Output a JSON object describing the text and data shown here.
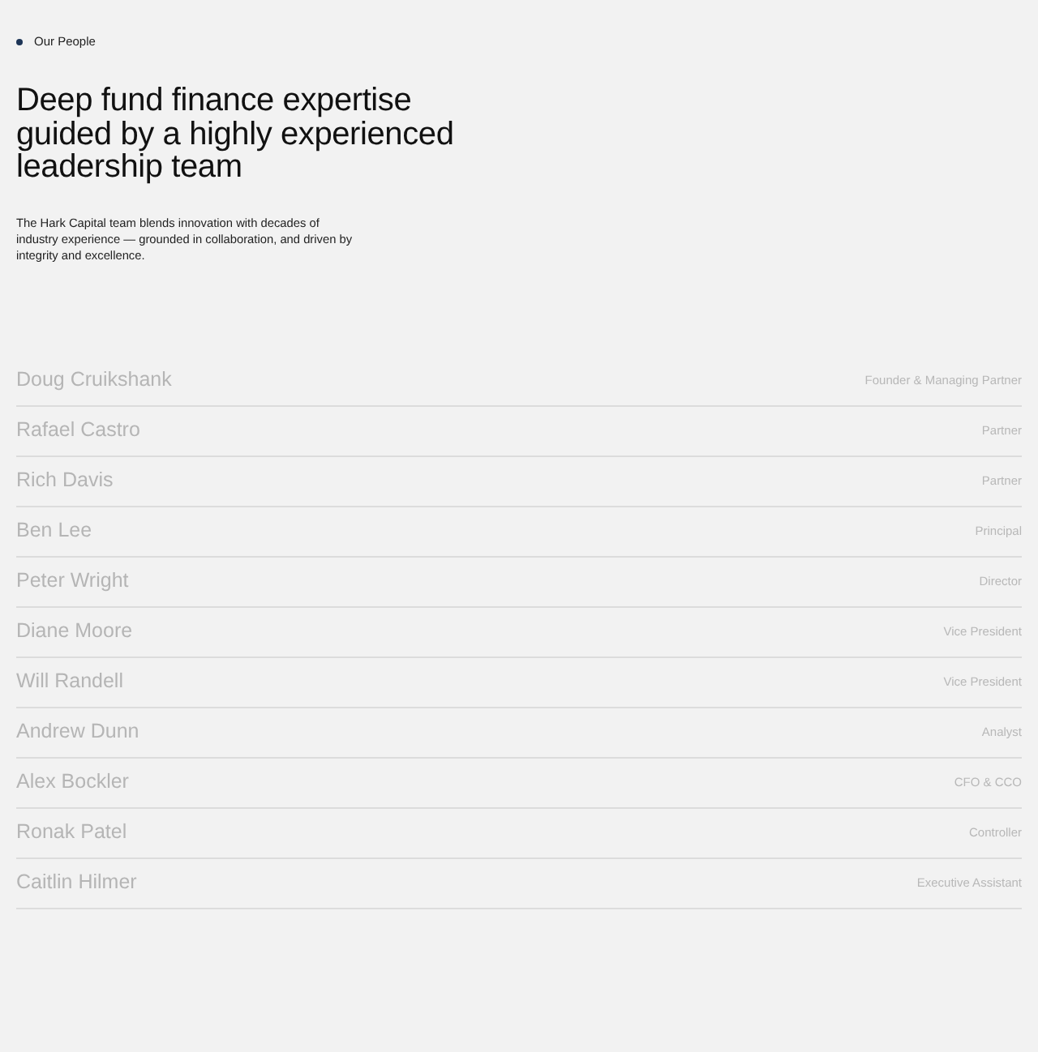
{
  "eyebrow": "Our People",
  "heading": "Deep fund finance expertise guided by a highly experienced leadership team",
  "intro": "The Hark Capital team blends innovation with decades of industry experience — grounded in collaboration, and driven by integrity and excellence.",
  "people": [
    {
      "name": "Doug Cruikshank",
      "role": "Founder & Managing Partner"
    },
    {
      "name": "Rafael Castro",
      "role": "Partner"
    },
    {
      "name": "Rich Davis",
      "role": "Partner"
    },
    {
      "name": "Ben Lee",
      "role": "Principal"
    },
    {
      "name": "Peter Wright",
      "role": "Director"
    },
    {
      "name": "Diane Moore",
      "role": "Vice President"
    },
    {
      "name": "Will Randell",
      "role": "Vice President"
    },
    {
      "name": "Andrew Dunn",
      "role": "Analyst"
    },
    {
      "name": "Alex Bockler",
      "role": "CFO & CCO"
    },
    {
      "name": "Ronak Patel",
      "role": "Controller"
    },
    {
      "name": "Caitlin Hilmer",
      "role": "Executive Assistant"
    }
  ]
}
